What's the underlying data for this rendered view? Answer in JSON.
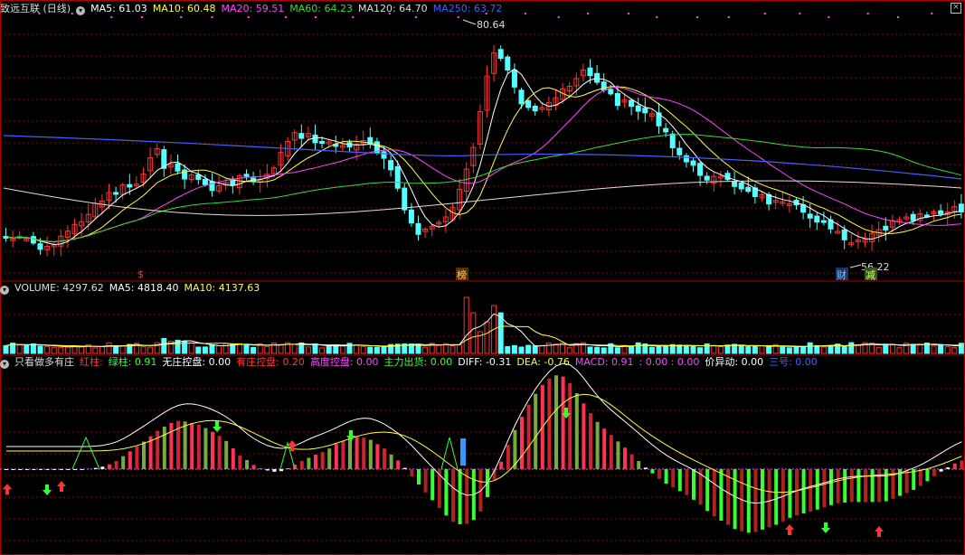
{
  "main": {
    "title": "致远互联 (日线)",
    "ma": [
      {
        "label": "MA5: 61.03",
        "color": "#ffffff"
      },
      {
        "label": "MA10: 60.48",
        "color": "#ffff33"
      },
      {
        "label": "MA20: 59.51",
        "color": "#ff44ff"
      },
      {
        "label": "MA60: 64.23",
        "color": "#33dd33"
      },
      {
        "label": "MA120: 64.70",
        "color": "#dddddd"
      },
      {
        "label": "MA250: 63.72",
        "color": "#4060ff"
      }
    ],
    "high_label": "80.64",
    "low_label": "56.22",
    "marker_s": "$",
    "marker_bang": "榜",
    "marker_cai": "财",
    "marker_jian": "减"
  },
  "volume": {
    "labels": [
      {
        "label": "VOLUME: 4297.62",
        "color": "#dddddd"
      },
      {
        "label": "MA5: 4818.40",
        "color": "#ffffff"
      },
      {
        "label": "MA10: 4137.63",
        "color": "#ffff33"
      }
    ]
  },
  "indicator": {
    "name": "只看做多有庄",
    "labels": [
      {
        "label": "红柱:",
        "color": "#ff3333"
      },
      {
        "label": "绿柱: 0.91",
        "color": "#33ff33"
      },
      {
        "label": "无庄控盘: 0.00",
        "color": "#ffffff"
      },
      {
        "label": "有庄控盘: 0.20",
        "color": "#ff3333"
      },
      {
        "label": "高度控盘: 0.00",
        "color": "#ff44ff"
      },
      {
        "label": "主力出货: 0.00",
        "color": "#33ff33"
      },
      {
        "label": "DIFF: -0.31",
        "color": "#ffffff"
      },
      {
        "label": "DEA: -0.76",
        "color": "#ffff33"
      },
      {
        "label": "MACD: 0.91",
        "color": "#ff44ff"
      },
      {
        "label": ": 0.00 : 0.00",
        "color": "#ff44ff"
      },
      {
        "label": "价异动: 0.00",
        "color": "#ffffff"
      },
      {
        "label": "三号: 0.00",
        "color": "#4060ff"
      }
    ]
  },
  "colors": {
    "up": "#ff3232",
    "down": "#54ffff",
    "grid": "#8b0000"
  }
}
